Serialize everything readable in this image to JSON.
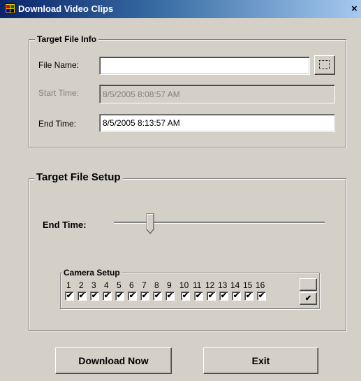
{
  "window": {
    "title": "Download Video Clips",
    "close_glyph": "×",
    "icon": "app-icon"
  },
  "target_file_info": {
    "legend": "Target File Info",
    "file_name_label": "File Name:",
    "file_name_value": "",
    "browse_glyph": "…",
    "start_time_label": "Start Time:",
    "start_time_value": "8/5/2005 8:08:57 AM",
    "end_time_label": "End Time:",
    "end_time_value": "8/5/2005 8:13:57 AM"
  },
  "target_file_setup": {
    "legend": "Target File Setup",
    "end_time_label": "End Time:",
    "slider_position": 0.2,
    "camera_setup": {
      "legend": "Camera Setup",
      "cameras": [
        {
          "num": "1",
          "checked": true
        },
        {
          "num": "2",
          "checked": true
        },
        {
          "num": "3",
          "checked": true
        },
        {
          "num": "4",
          "checked": true
        },
        {
          "num": "5",
          "checked": true
        },
        {
          "num": "6",
          "checked": true
        },
        {
          "num": "7",
          "checked": true
        },
        {
          "num": "8",
          "checked": true
        },
        {
          "num": "9",
          "checked": true
        },
        {
          "num": "10",
          "checked": true
        },
        {
          "num": "11",
          "checked": true
        },
        {
          "num": "12",
          "checked": true
        },
        {
          "num": "13",
          "checked": true
        },
        {
          "num": "14",
          "checked": true
        },
        {
          "num": "15",
          "checked": true
        },
        {
          "num": "16",
          "checked": true
        }
      ],
      "check_glyph": "✔",
      "select_all_glyph": "✔"
    }
  },
  "buttons": {
    "download": "Download Now",
    "exit": "Exit"
  },
  "colors": {
    "titlebar_start": "#0a246a",
    "titlebar_end": "#a6caf0",
    "face": "#d4d0c8"
  }
}
